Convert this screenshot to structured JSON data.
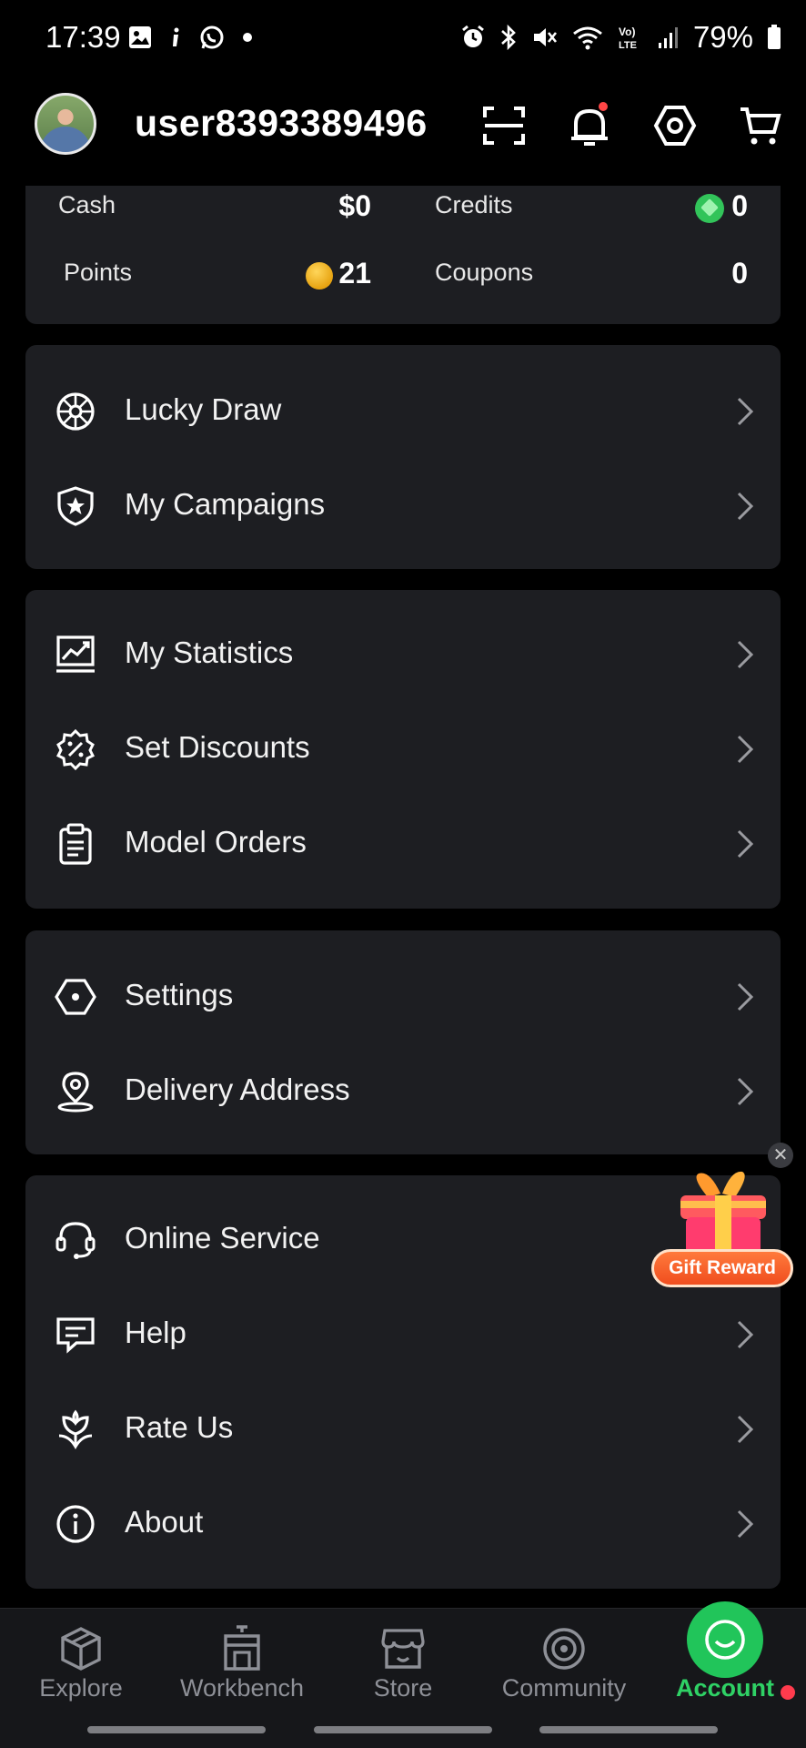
{
  "status_bar": {
    "time": "17:39",
    "battery": "79%",
    "left_icons": [
      "image-icon",
      "info-icon",
      "whatsapp-icon",
      "dot-icon"
    ],
    "right_icons": [
      "alarm-icon",
      "bluetooth-icon",
      "mute-icon",
      "wifi-icon",
      "volte-icon",
      "signal-icon",
      "battery-icon"
    ]
  },
  "header": {
    "username": "user8393389496",
    "icons": [
      "scan-icon",
      "bell-icon",
      "settings-icon",
      "cart-icon"
    ]
  },
  "wallet": {
    "cash_label": "Cash",
    "cash_value": "$0",
    "credits_label": "Credits",
    "credits_value": "0",
    "points_label": "Points",
    "points_value": "21",
    "coupons_label": "Coupons",
    "coupons_value": "0"
  },
  "groups": [
    {
      "items": [
        {
          "label": "Lucky Draw",
          "icon": "wheel-icon"
        },
        {
          "label": "My Campaigns",
          "icon": "shield-star-icon"
        }
      ]
    },
    {
      "items": [
        {
          "label": "My Statistics",
          "icon": "chart-icon"
        },
        {
          "label": "Set Discounts",
          "icon": "discount-icon"
        },
        {
          "label": "Model Orders",
          "icon": "clipboard-icon"
        }
      ]
    },
    {
      "items": [
        {
          "label": "Settings",
          "icon": "hexagon-gear-icon"
        },
        {
          "label": "Delivery Address",
          "icon": "location-icon"
        }
      ]
    },
    {
      "items": [
        {
          "label": "Online Service",
          "icon": "headset-icon"
        },
        {
          "label": "Help",
          "icon": "message-icon"
        },
        {
          "label": "Rate Us",
          "icon": "flower-icon"
        },
        {
          "label": "About",
          "icon": "info-circle-icon"
        }
      ]
    }
  ],
  "gift": {
    "label": "Gift Reward"
  },
  "bottom_nav": {
    "items": [
      {
        "label": "Explore",
        "icon": "cube-icon"
      },
      {
        "label": "Workbench",
        "icon": "printer-icon"
      },
      {
        "label": "Store",
        "icon": "store-icon"
      },
      {
        "label": "Community",
        "icon": "target-icon"
      },
      {
        "label": "Account",
        "icon": "smile-icon",
        "active": true
      }
    ]
  },
  "colors": {
    "background": "#000000",
    "card": "#1d1e22",
    "accent": "#21c55a",
    "notification": "#ff4646"
  }
}
